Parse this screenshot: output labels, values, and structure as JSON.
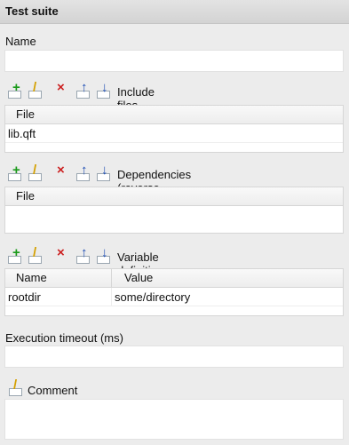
{
  "panel_title": "Test suite",
  "name": {
    "label": "Name",
    "value": ""
  },
  "include_files": {
    "title": "Include files",
    "columns": [
      "File"
    ],
    "rows": [
      [
        "lib.qft"
      ]
    ]
  },
  "dependencies": {
    "title": "Dependencies (reverse includes)",
    "columns": [
      "File"
    ],
    "rows": []
  },
  "variables": {
    "title": "Variable definitions",
    "columns": [
      "Name",
      "Value"
    ],
    "rows": [
      [
        "rootdir",
        "some/directory"
      ]
    ]
  },
  "timeout": {
    "label": "Execution timeout (ms)",
    "value": ""
  },
  "comment": {
    "label": "Comment",
    "value": ""
  },
  "icons": {
    "add": "add-icon",
    "edit": "edit-icon",
    "delete": "delete-icon",
    "up": "move-up-icon",
    "down": "move-down-icon"
  },
  "colors": {
    "add": "#1a9a1a",
    "edit": "#d4a000",
    "delete": "#cc1f1f",
    "arrows": "#1f4fb5"
  }
}
